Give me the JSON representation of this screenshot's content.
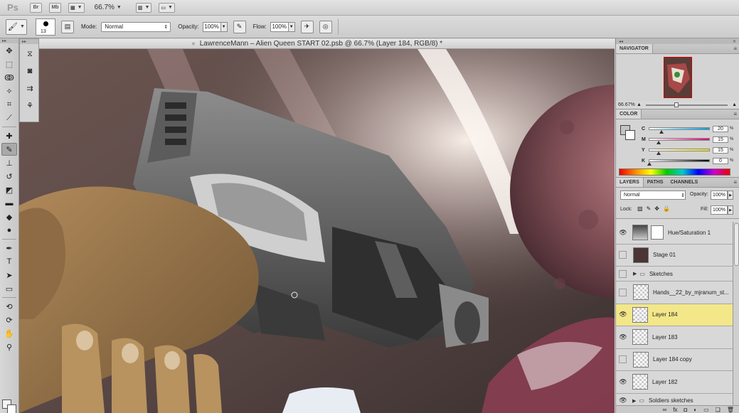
{
  "app": {
    "logo": "Ps",
    "bridge_label": "Br",
    "minibridge_label": "Mb",
    "zoom_level": "66.7%"
  },
  "options_bar": {
    "brush_size": "13",
    "mode_label": "Mode:",
    "mode_value": "Normal",
    "opacity_label": "Opacity:",
    "opacity_value": "100%",
    "flow_label": "Flow:",
    "flow_value": "100%"
  },
  "document": {
    "title": "LawrenceMann – Alien Queen START 02.psb @ 66.7% (Layer 184, RGB/8) *"
  },
  "navigator": {
    "tab": "NAVIGATOR",
    "zoom": "66.67%"
  },
  "color": {
    "tab": "COLOR",
    "channels": [
      {
        "label": "C",
        "value": "20",
        "knob": 0.2,
        "gradient": "linear-gradient(90deg,#fff,#00a0e0)"
      },
      {
        "label": "M",
        "value": "15",
        "knob": 0.15,
        "gradient": "linear-gradient(90deg,#fff,#e0007a)"
      },
      {
        "label": "Y",
        "value": "15",
        "knob": 0.15,
        "gradient": "linear-gradient(90deg,#fff,#f0e000)"
      },
      {
        "label": "K",
        "value": "0",
        "knob": 0.0,
        "gradient": "linear-gradient(90deg,#fff,#000)"
      }
    ],
    "percent": "%",
    "foreground_hex": "#c4c4c4",
    "background_hex": "#ffffff"
  },
  "layers_panel": {
    "tabs": [
      "LAYERS",
      "PATHS",
      "CHANNELS"
    ],
    "blend_mode": "Normal",
    "opacity_label": "Opacity:",
    "opacity_value": "100%",
    "lock_label": "Lock:",
    "fill_label": "Fill:",
    "fill_value": "100%",
    "layers": [
      {
        "name": "Hue/Saturation 1",
        "visible": true,
        "kind": "adjustment"
      },
      {
        "name": "Stage 01",
        "visible": false,
        "kind": "image"
      },
      {
        "name": "Sketches",
        "visible": false,
        "kind": "group"
      },
      {
        "name": "Hands__22_by_mjranum_st...",
        "visible": false,
        "kind": "layer"
      },
      {
        "name": "Layer 184",
        "visible": true,
        "kind": "layer",
        "selected": true
      },
      {
        "name": "Layer 183",
        "visible": true,
        "kind": "layer"
      },
      {
        "name": "Layer 184 copy",
        "visible": false,
        "kind": "layer"
      },
      {
        "name": "Layer 182",
        "visible": true,
        "kind": "layer"
      },
      {
        "name": "Soldiers sketches",
        "visible": true,
        "kind": "group"
      }
    ],
    "footer_icons": [
      "link-icon",
      "fx-icon",
      "mask-icon",
      "adjustment-icon",
      "folder-icon",
      "new-layer-icon",
      "trash-icon"
    ]
  },
  "colors": {
    "selected_layer": "#f3e78a",
    "panel_bg": "#d8d8d8"
  }
}
